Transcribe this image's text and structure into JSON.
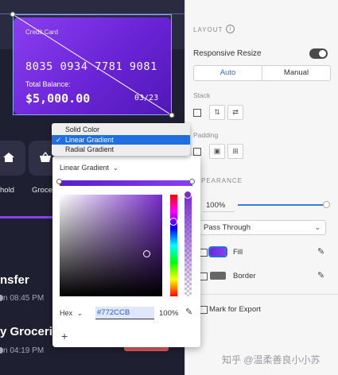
{
  "card": {
    "label": "Credit Card",
    "number": "8035 0934 7781 9081",
    "total_label": "Total Balance:",
    "balance": "$5,000.00",
    "expiry": "03/23",
    "gradient_colors": [
      "#8a3ff0",
      "#5018b6"
    ]
  },
  "categories": [
    {
      "label": "hold",
      "icon": "home-icon"
    },
    {
      "label": "Groceri",
      "icon": "basket-icon"
    }
  ],
  "transactions": [
    {
      "title": "nsfer",
      "time": "n 08:45 PM"
    },
    {
      "title": "y Groceri",
      "time": "n 04:19 PM"
    }
  ],
  "inspector": {
    "layout_heading": "LAYOUT",
    "responsive_resize_label": "Responsive Resize",
    "responsive_resize_on": true,
    "segment_auto": "Auto",
    "segment_manual": "Manual",
    "stack_heading": "Stack",
    "padding_heading": "Padding",
    "appearance_heading": "PEARANCE",
    "opacity": "100%",
    "opacity_value": 1.0,
    "blend_mode": "Pass Through",
    "fill_label": "Fill",
    "border_label": "Border",
    "export_label": "Mark for Export"
  },
  "picker": {
    "gradient_type": "Linear Gradient",
    "format": "Hex",
    "hex": "#772CCB",
    "alpha": "100%",
    "add_label": "+"
  },
  "menu": {
    "items": [
      "Solid Color",
      "Linear Gradient",
      "Radial Gradient"
    ],
    "selected": "Linear Gradient"
  },
  "watermark": "知乎 @温柔善良小小苏",
  "colors": {
    "accent": "#1f6fe0",
    "selected_color": "#772CCB",
    "dark_bg": "#1e1f30",
    "danger_chip": "#e05a5a"
  }
}
